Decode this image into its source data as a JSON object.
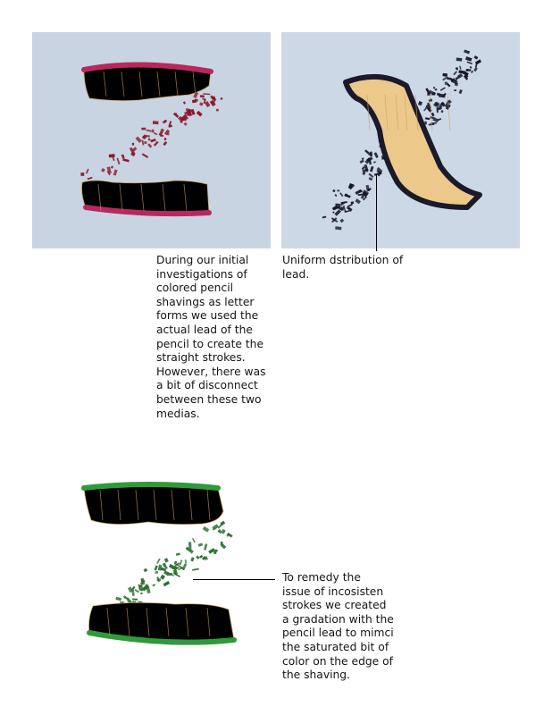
{
  "figures": [
    {
      "id": "red-z",
      "alt": "Z letterform made of red colored pencil shavings and red lead crumbs",
      "colors": {
        "background": "#c9d4e2",
        "edge": "#b8285e",
        "lead": "#8a1424",
        "wood": "#ecc98a"
      }
    },
    {
      "id": "black-x",
      "alt": "Letterform made of black pencil shavings with black lead crumbs",
      "colors": {
        "background": "#cdd8e6",
        "edge": "#1a1a2a",
        "lead": "#15152a",
        "wood": "#ecc98a"
      }
    },
    {
      "id": "green-z",
      "alt": "Z letterform made of green pencil shavings with green lead crumbs",
      "colors": {
        "background": "#ffffff",
        "edge": "#2f9a3a",
        "lead": "#2b6e2f",
        "wood": "#f0d29c"
      }
    }
  ],
  "captions": {
    "initial": [
      "During our initial",
      "investigations of",
      "colored pencil",
      "shavings as letter",
      "forms we used the",
      "actual lead of the",
      "pencil to create the",
      "straight strokes.",
      "However, there was",
      "a bit of disconnect",
      "between these two",
      "medias."
    ],
    "uniform": [
      "Uniform dstribution of",
      "lead."
    ],
    "remedy": [
      "To remedy the",
      "issue of incosisten",
      "strokes we created",
      "a gradation with the",
      "pencil lead to mimci",
      "the saturated bit of",
      "color on the edge of",
      "the shaving."
    ]
  }
}
